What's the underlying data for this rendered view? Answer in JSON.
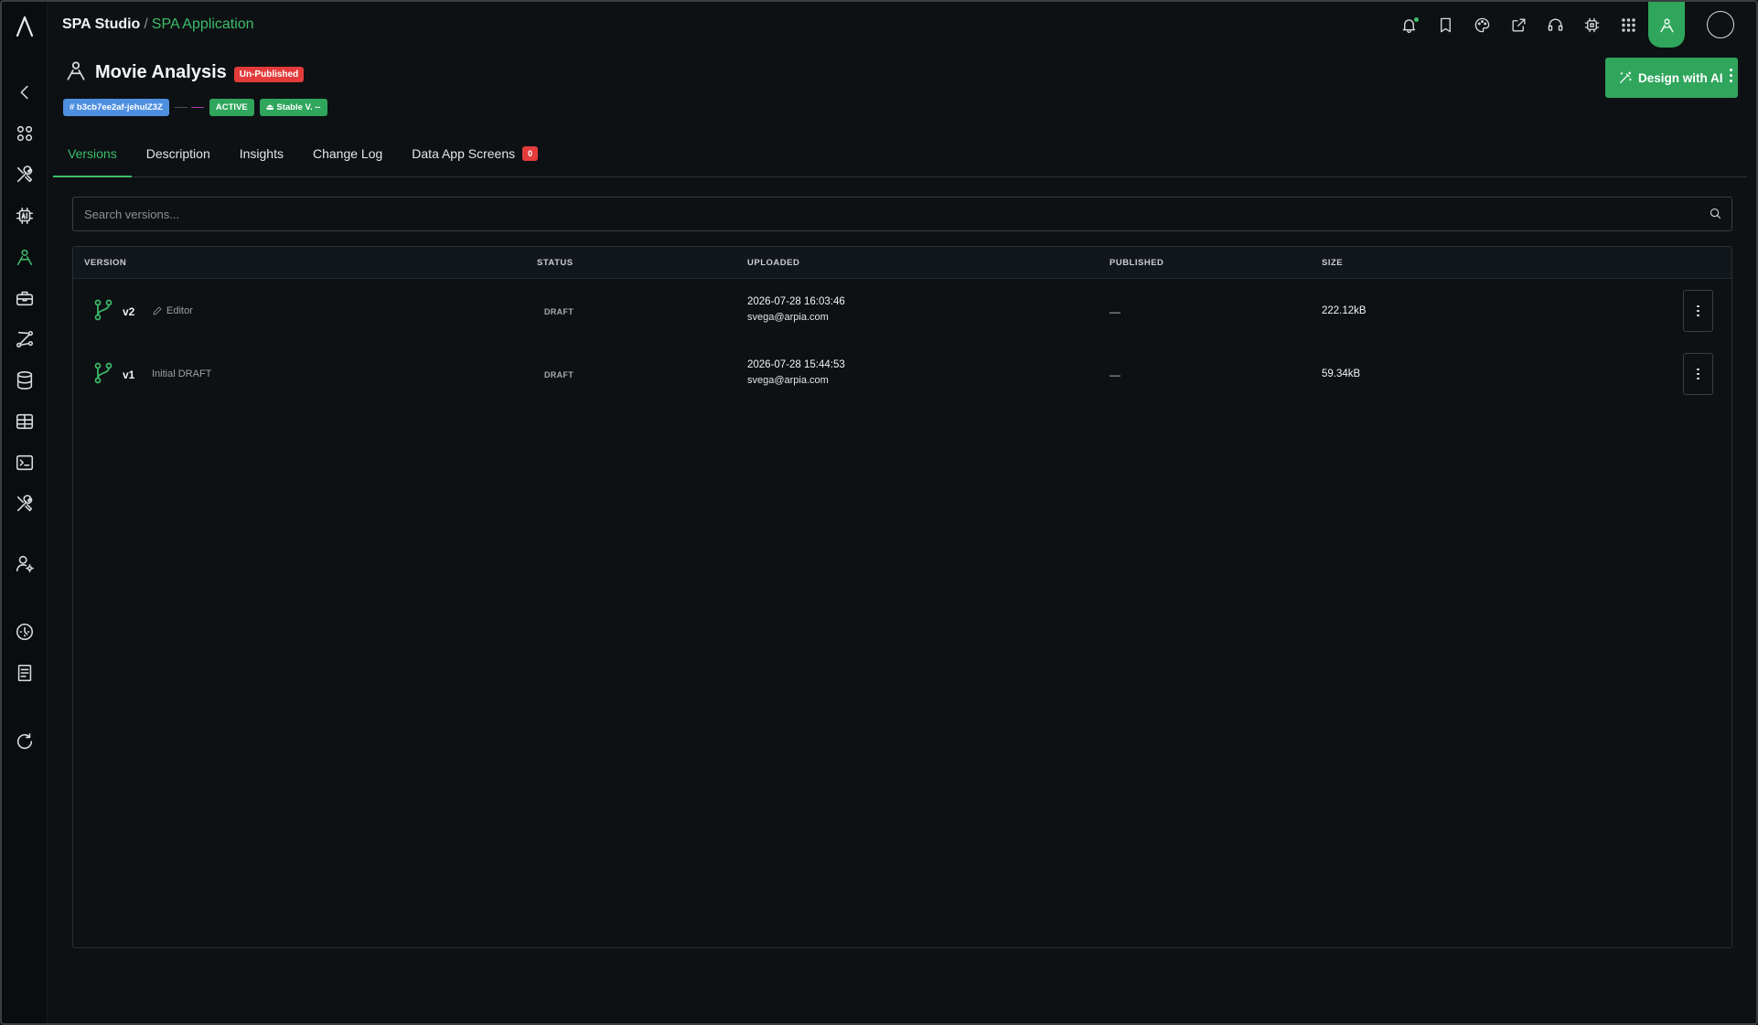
{
  "breadcrumb": {
    "studio": "SPA Studio",
    "separator": "/",
    "app": "SPA Application"
  },
  "header_icons": [
    "bell-icon",
    "bookmark-icon",
    "palette-icon",
    "share-icon",
    "headset-icon",
    "chip-icon",
    "apps-grid-icon",
    "designer-icon"
  ],
  "page": {
    "title": "Movie Analysis",
    "publish_badge": "Un-Published",
    "hash_tag": "# b3cb7ee2af-jehuIZ3Z",
    "status_tag": "ACTIVE",
    "stable_tag": "⏏ Stable V. --"
  },
  "design_button": {
    "label": "Design with AI"
  },
  "tabs": [
    {
      "label": "Versions",
      "active": true
    },
    {
      "label": "Description"
    },
    {
      "label": "Insights"
    },
    {
      "label": "Change Log"
    },
    {
      "label": "Data App Screens",
      "count": "0"
    }
  ],
  "search": {
    "placeholder": "Search versions..."
  },
  "table": {
    "columns": {
      "version": "VERSION",
      "status": "STATUS",
      "uploaded": "UPLOADED",
      "published": "PUBLISHED",
      "size": "SIZE"
    },
    "rows": [
      {
        "version": "v2",
        "note": "Editor",
        "note_icon": "pencil-icon",
        "status": "DRAFT",
        "date": "2026-07-28 16:03:46",
        "user": "svega@arpia.com",
        "published": "—",
        "size": "222.12kB"
      },
      {
        "version": "v1",
        "note": "Initial DRAFT",
        "status": "DRAFT",
        "date": "2026-07-28 15:44:53",
        "user": "svega@arpia.com",
        "published": "—",
        "size": "59.34kB"
      }
    ]
  },
  "colors": {
    "accent": "#3dbd6a",
    "danger": "#e33b3b",
    "info": "#4f8fe0",
    "background": "#0d1114"
  }
}
